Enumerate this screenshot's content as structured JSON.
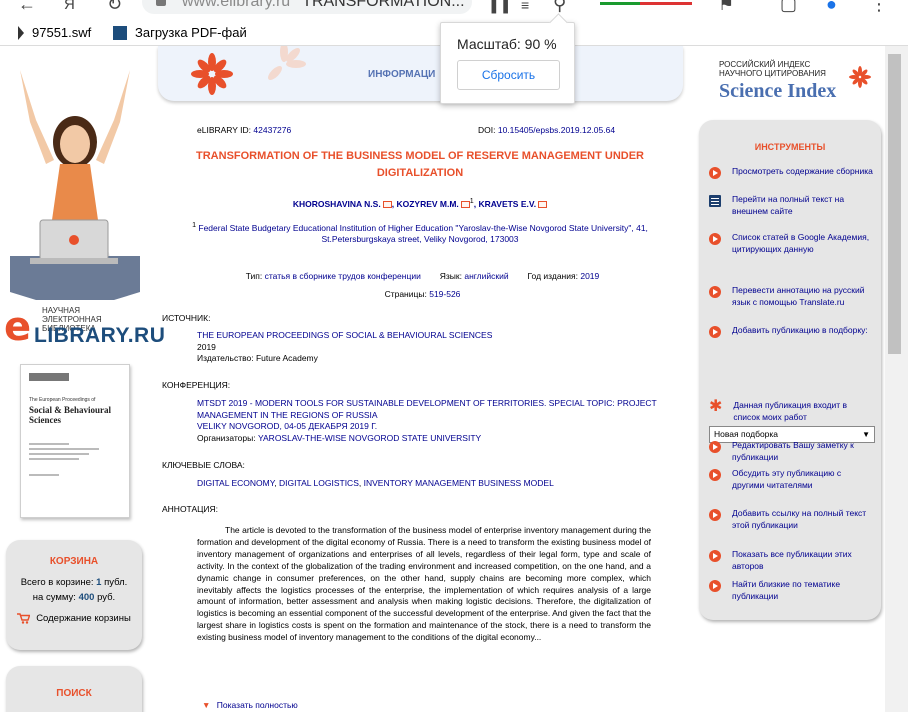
{
  "browser": {
    "tab_letter": "Я",
    "address_host": "www.elibrary.ru",
    "address_title": "TRANSFORMATION...",
    "bookmarks": [
      {
        "label": "97551.swf"
      },
      {
        "label": "Загрузка PDF-фай"
      }
    ],
    "zoom_popup": {
      "label": "Масштаб: 90 %",
      "reset_label": "Сбросить"
    }
  },
  "left": {
    "logo_caption": "НАУЧНАЯ ЭЛЕКТРОННАЯ БИБЛИОТЕКА",
    "logo_name": "LIBRARY.RU",
    "cover": {
      "pre": "The European Proceedings of",
      "title": "Social & Behavioural Sciences"
    },
    "cart": {
      "title": "КОРЗИНА",
      "total_prefix": "Всего в корзине:",
      "total_value": "1",
      "total_unit": "публ.",
      "sum_prefix": "на сумму:",
      "sum_value": "400",
      "sum_unit": "руб.",
      "contents_link": "Содержание корзины"
    },
    "search": {
      "title": "ПОИСК"
    }
  },
  "banner": {
    "title": "ИНФОРМАЦИ"
  },
  "publication": {
    "elibrary_id_label": "eLIBRARY ID:",
    "elibrary_id": "42437276",
    "doi_label": "DOI:",
    "doi": "10.15405/epsbs.2019.12.05.64",
    "title": "TRANSFORMATION OF THE BUSINESS MODEL OF RESERVE MANAGEMENT UNDER DIGITALIZATION",
    "authors": [
      {
        "name": "KHOROSHAVINA N.S.",
        "sep": ","
      },
      {
        "name": "KOZYREV M.M.",
        "sup": "1",
        "sep": ","
      },
      {
        "name": "KRAVETS E.V.",
        "sep": ""
      }
    ],
    "affiliation_sup": "1",
    "affiliation": "Federal State Budgetary Educational Institution of Higher Education \"Yaroslav-the-Wise Novgorod State University\", 41, St.Petersburgskaya street, Veliky Novgorod, 173003",
    "type_label": "Тип:",
    "type_value": "статья в сборнике трудов конференции",
    "lang_label": "Язык:",
    "lang_value": "английский",
    "year_label": "Год издания:",
    "year_value": "2019",
    "pages_label": "Страницы:",
    "pages_value": "519-526",
    "source": {
      "heading": "ИСТОЧНИК:",
      "title": "THE EUROPEAN PROCEEDINGS OF SOCIAL & BEHAVIOURAL SCIENCES",
      "year": "2019",
      "publisher_label": "Издательство:",
      "publisher": "Future Academy"
    },
    "conference": {
      "heading": "КОНФЕРЕНЦИЯ:",
      "title": "MTSDT 2019 - MODERN TOOLS FOR SUSTAINABLE DEVELOPMENT OF TERRITORIES. SPECIAL TOPIC: PROJECT MANAGEMENT IN THE REGIONS OF RUSSIA",
      "place_date": "Veliky Novgorod, 04-05 декабря 2019 г.",
      "organizers_label": "Организаторы:",
      "organizers": "Yaroslav-the-Wise Novgorod State University"
    },
    "keywords": {
      "heading": "КЛЮЧЕВЫЕ СЛОВА:",
      "items": [
        "DIGITAL ECONOMY",
        "DIGITAL LOGISTICS",
        "INVENTORY MANAGEMENT BUSINESS MODEL"
      ]
    },
    "annotation": {
      "heading": "АННОТАЦИЯ:",
      "text": "The article is devoted to the transformation of the business model of enterprise inventory management during the formation and development of the digital economy of Russia. There is a need to transform the existing business model of inventory management of organizations and enterprises of all levels, regardless of their legal form, type and scale of activity. In the context of the globalization of the trading environment and increased competition, on the one hand, and a dynamic change in consumer preferences, on the other hand, supply chains are becoming more complex, which inevitably affects the logistics processes of the enterprise, the implementation of which requires analysis of a large amount of information, better assessment and analysis when making logistic decisions. Therefore, the digitalization of logistics is becoming an essential component of the successful development of the enterprise. And given the fact that the largest share in logistics costs is spent on the formation and maintenance of the stock, there is a need to transform the existing business model of inventory management to the conditions of the digital economy...",
      "show_more": "Показать полностью"
    }
  },
  "right": {
    "si_caption": "РОССИЙСКИЙ ИНДЕКС НАУЧНОГО ЦИТИРОВАНИЯ",
    "si_name": "Science Index",
    "tools_title": "ИНСТРУМЕНТЫ",
    "tools": [
      {
        "label": "Просмотреть содержание сборника",
        "icon": "play-dot"
      },
      {
        "label": "Перейти на полный текст на внешнем сайте",
        "icon": "document"
      },
      {
        "label": "Список статей в Google Академия, цитирующих данную",
        "icon": "play-dot"
      },
      {
        "label": "Перевести аннотацию на русский язык с помощью Translate.ru",
        "icon": "play-dot"
      },
      {
        "label": "Добавить публикацию в подборку:",
        "icon": "play-dot"
      },
      {
        "label": "Данная публикация входит в список моих работ",
        "icon": "asterisk"
      },
      {
        "label": "Редактировать Вашу заметку к публикации",
        "icon": "play-dot"
      },
      {
        "label": "Обсудить эту публикацию с другими читателями",
        "icon": "play-dot"
      },
      {
        "label": "Добавить ссылку на полный текст этой публикации",
        "icon": "play-dot"
      },
      {
        "label": "Показать все публикации этих авторов",
        "icon": "play-dot"
      },
      {
        "label": "Найти близкие по тематике публикации",
        "icon": "play-dot"
      }
    ],
    "selection_value": "Новая подборка"
  },
  "colors": {
    "accent": "#e8502b",
    "link": "#00008f",
    "brand_blue": "#1d4d7c"
  }
}
